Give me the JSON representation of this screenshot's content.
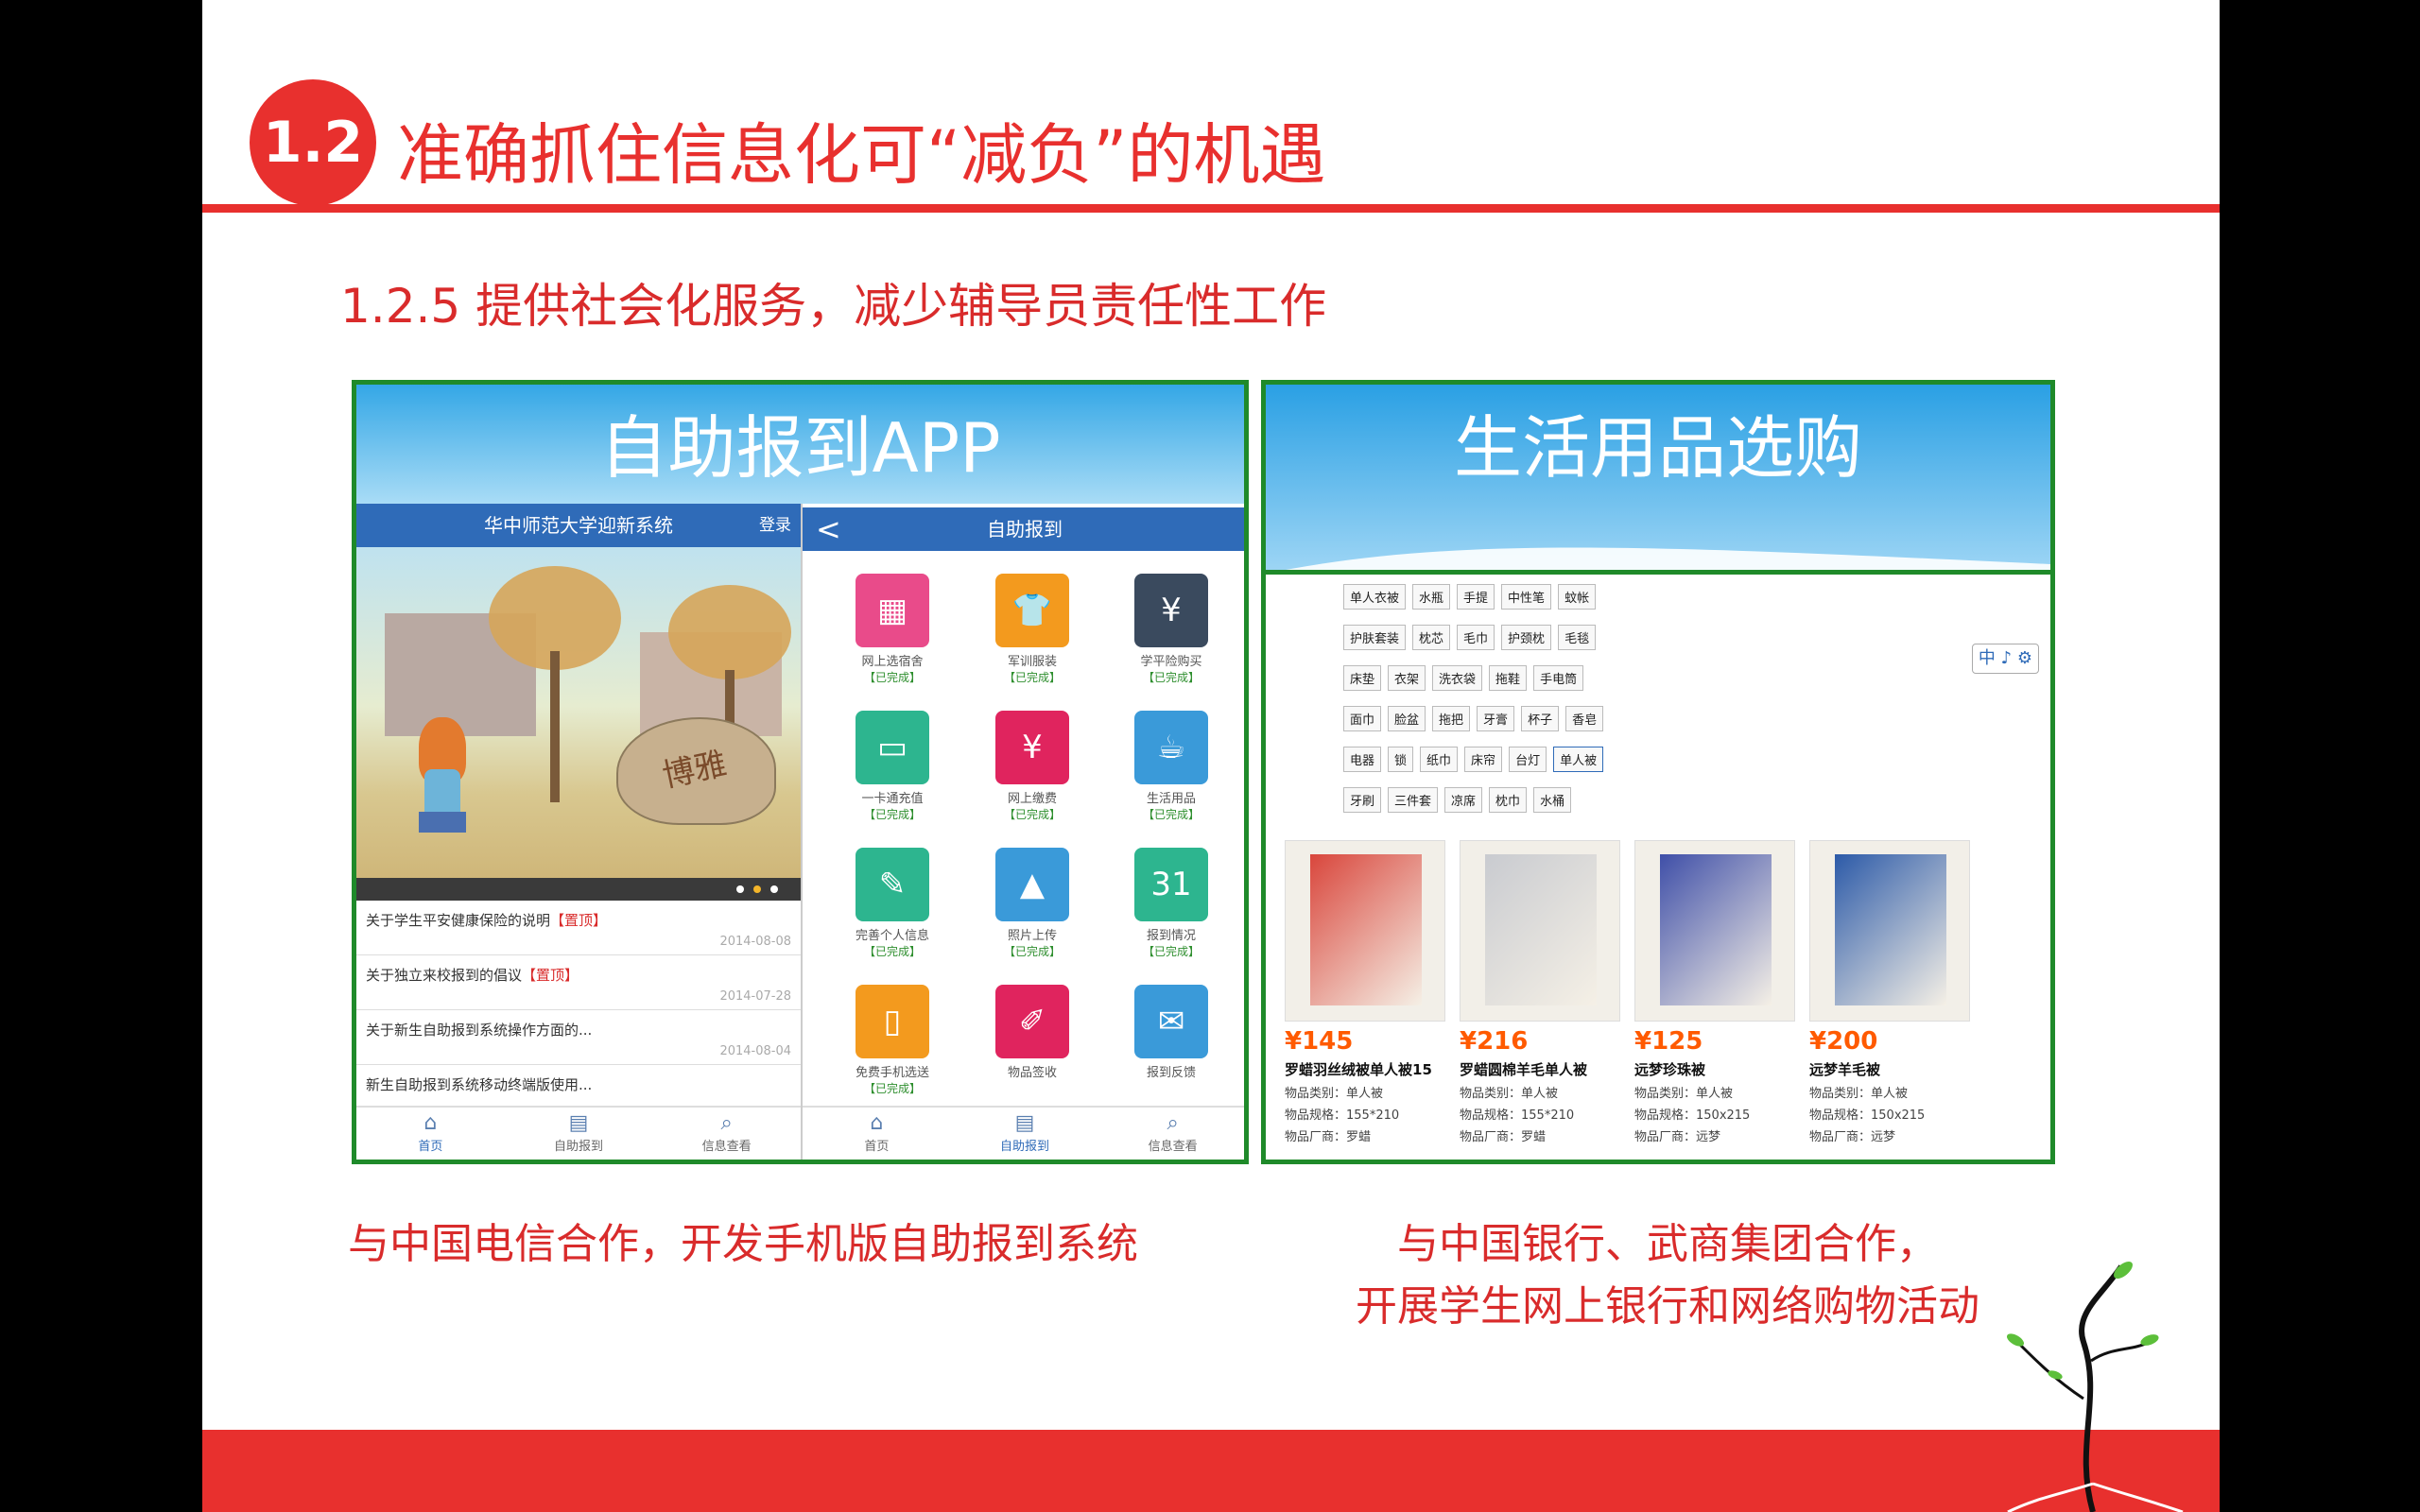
{
  "slide": {
    "badge": "1.2",
    "title": "准确抓住信息化可“减负”的机遇",
    "subtitle": "1.2.5 提供社会化服务，减少辅导员责任性工作",
    "accent_color": "#e8302e"
  },
  "app_panel": {
    "title": "自助报到APP",
    "home": {
      "header": "华中师范大学迎新系统",
      "login": "登录",
      "rock_text": "博雅",
      "news": [
        {
          "title": "关于学生平安健康保险的说明",
          "tag": "【置顶】",
          "date": "2014-08-08"
        },
        {
          "title": "关于独立来校报到的倡议",
          "tag": "【置顶】",
          "date": "2014-07-28"
        },
        {
          "title": "关于新生自助报到系统操作方面的...",
          "tag": "",
          "date": "2014-08-04"
        },
        {
          "title": "新生自助报到系统移动终端版使用...",
          "tag": "",
          "date": ""
        }
      ],
      "tabs": [
        {
          "label": "首页",
          "icon": "home-icon"
        },
        {
          "label": "自助报到",
          "icon": "id-card-icon"
        },
        {
          "label": "信息查看",
          "icon": "search-doc-icon"
        }
      ]
    },
    "checkin": {
      "header": "自助报到",
      "back": "<",
      "items": [
        {
          "label": "网上选宿舍",
          "status": "【已完成】",
          "color": "#e94b8a",
          "icon": "building-icon",
          "glyph": "▦"
        },
        {
          "label": "军训服装",
          "status": "【已完成】",
          "color": "#f39a1e",
          "icon": "tshirt-icon",
          "glyph": "👕"
        },
        {
          "label": "学平险购买",
          "status": "【已完成】",
          "color": "#3a4a5e",
          "icon": "receipt-icon",
          "glyph": "¥"
        },
        {
          "label": "一卡通充值",
          "status": "【已完成】",
          "color": "#2db58f",
          "icon": "card-icon",
          "glyph": "▭"
        },
        {
          "label": "网上缴费",
          "status": "【已完成】",
          "color": "#e0245e",
          "icon": "monitor-icon",
          "glyph": "¥"
        },
        {
          "label": "生活用品",
          "status": "【已完成】",
          "color": "#3a9ad9",
          "icon": "cup-icon",
          "glyph": "☕"
        },
        {
          "label": "完善个人信息",
          "status": "【已完成】",
          "color": "#2db58f",
          "icon": "profile-icon",
          "glyph": "✎"
        },
        {
          "label": "照片上传",
          "status": "【已完成】",
          "color": "#3a9ad9",
          "icon": "photo-icon",
          "glyph": "▲"
        },
        {
          "label": "报到情况",
          "status": "【已完成】",
          "color": "#2db58f",
          "icon": "calendar-icon",
          "glyph": "31"
        },
        {
          "label": "免费手机选送",
          "status": "【已完成】",
          "color": "#f39a1e",
          "icon": "phone-icon",
          "glyph": "▯"
        },
        {
          "label": "物品签收",
          "status": "",
          "color": "#e0245e",
          "icon": "pen-icon",
          "glyph": "✐"
        },
        {
          "label": "报到反馈",
          "status": "",
          "color": "#3a9ad9",
          "icon": "envelope-icon",
          "glyph": "✉"
        }
      ],
      "tabs": [
        {
          "label": "首页",
          "icon": "home-icon"
        },
        {
          "label": "自助报到",
          "icon": "id-card-icon"
        },
        {
          "label": "信息查看",
          "icon": "search-doc-icon"
        }
      ]
    }
  },
  "shop_panel": {
    "title": "生活用品选购",
    "tag_rows": [
      [
        "单人衣被",
        "水瓶",
        "手提",
        "中性笔",
        "蚊帐"
      ],
      [
        "护肤套装",
        "枕芯",
        "毛巾",
        "护颈枕",
        "毛毯"
      ],
      [
        "床垫",
        "衣架",
        "洗衣袋",
        "拖鞋",
        "手电筒"
      ],
      [
        "面巾",
        "脸盆",
        "拖把",
        "牙膏",
        "杯子",
        "香皂"
      ],
      [
        "电器",
        "锁",
        "纸巾",
        "床帘",
        "台灯",
        "单人被"
      ],
      [
        "牙刷",
        "三件套",
        "凉席",
        "枕巾",
        "水桶"
      ]
    ],
    "selected_tag": "单人被",
    "ime_text": "中 ♪ ⚙",
    "products": [
      {
        "price": "¥145",
        "name": "罗蜡羽丝绒被单人被15",
        "category": "物品类别：单人被",
        "spec": "物品规格：155*210",
        "maker": "物品厂商：罗蜡",
        "color": "#d9463c"
      },
      {
        "price": "¥216",
        "name": "罗蜡圆棉羊毛单人被",
        "category": "物品类别：单人被",
        "spec": "物品规格：155*210",
        "maker": "物品厂商：罗蜡",
        "color": "#c9cbd0"
      },
      {
        "price": "¥125",
        "name": "远梦珍珠被",
        "category": "物品类别：单人被",
        "spec": "物品规格：150x215",
        "maker": "物品厂商：远梦",
        "color": "#3f4fa8"
      },
      {
        "price": "¥200",
        "name": "远梦羊毛被",
        "category": "物品类别：单人被",
        "spec": "物品规格：150x215",
        "maker": "物品厂商：远梦",
        "color": "#2c5aa8"
      }
    ]
  },
  "captions": {
    "left": "与中国电信合作，开发手机版自助报到系统",
    "right_line1": "与中国银行、武商集团合作，",
    "right_line2": "开展学生网上银行和网络购物活动"
  }
}
